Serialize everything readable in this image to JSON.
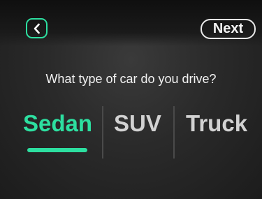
{
  "header": {
    "back_icon": "chevron-left-icon",
    "next_label": "Next"
  },
  "question": "What type of car do you drive?",
  "options": [
    {
      "label": "Sedan",
      "selected": true
    },
    {
      "label": "SUV",
      "selected": false
    },
    {
      "label": "Truck",
      "selected": false
    }
  ],
  "colors": {
    "accent": "#2ddfa0",
    "background": "#2a2a2a",
    "text": "#f2f2f2",
    "inactive_text": "#d2d2d2"
  }
}
